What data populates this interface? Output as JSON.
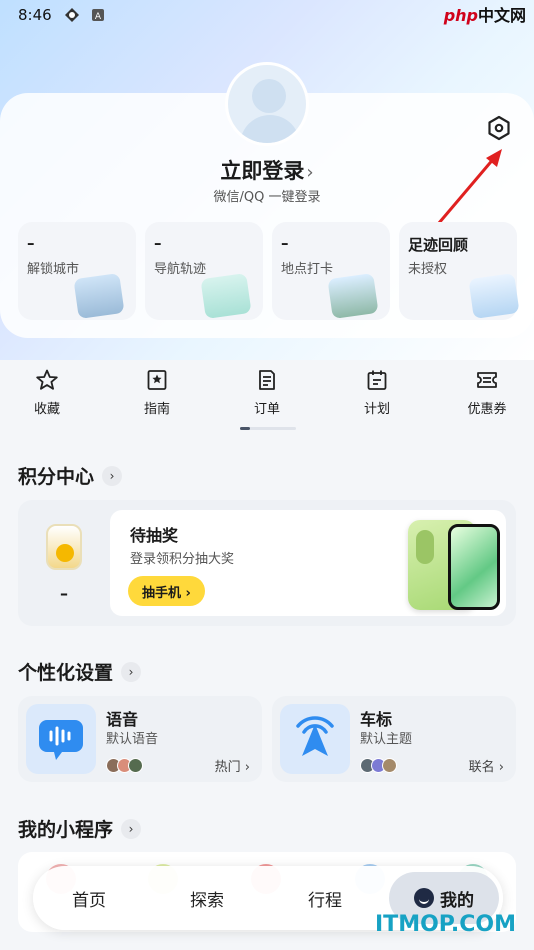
{
  "status_bar": {
    "time": "8:46"
  },
  "watermark_top": {
    "brand": "php",
    "suffix": "中文网"
  },
  "profile": {
    "login_title": "立即登录",
    "login_chevron": "›",
    "login_sub": "微信/QQ 一键登录"
  },
  "stats": [
    {
      "value": "–",
      "label": "解锁城市"
    },
    {
      "value": "–",
      "label": "导航轨迹"
    },
    {
      "value": "–",
      "label": "地点打卡"
    },
    {
      "value": "足迹回顾",
      "label": "未授权"
    }
  ],
  "quick_nav": [
    {
      "label": "收藏",
      "icon": "star-icon"
    },
    {
      "label": "指南",
      "icon": "guide-icon"
    },
    {
      "label": "订单",
      "icon": "order-icon"
    },
    {
      "label": "计划",
      "icon": "calendar-icon"
    },
    {
      "label": "优惠券",
      "icon": "coupon-icon"
    }
  ],
  "points": {
    "section_title": "积分中心",
    "go": "›",
    "balance": "–",
    "title": "待抽奖",
    "subtitle": "登录领积分抽大奖",
    "button": "抽手机 ›"
  },
  "personalize": {
    "section_title": "个性化设置",
    "go": "›",
    "cards": [
      {
        "title": "语音",
        "subtitle": "默认语音",
        "tag": "热门 ›"
      },
      {
        "title": "车标",
        "subtitle": "默认主题",
        "tag": "联名 ›"
      }
    ]
  },
  "mini_programs": {
    "section_title": "我的小程序",
    "go": "›"
  },
  "bottom_nav": {
    "home": "首页",
    "explore": "探索",
    "trip": "行程",
    "mine": "我的"
  },
  "watermark_bottom": "ITMOP.COM",
  "colors": {
    "accent_yellow": "#ffd93b",
    "arrow_red": "#e02020",
    "watermark_blue": "#17a2c4"
  }
}
